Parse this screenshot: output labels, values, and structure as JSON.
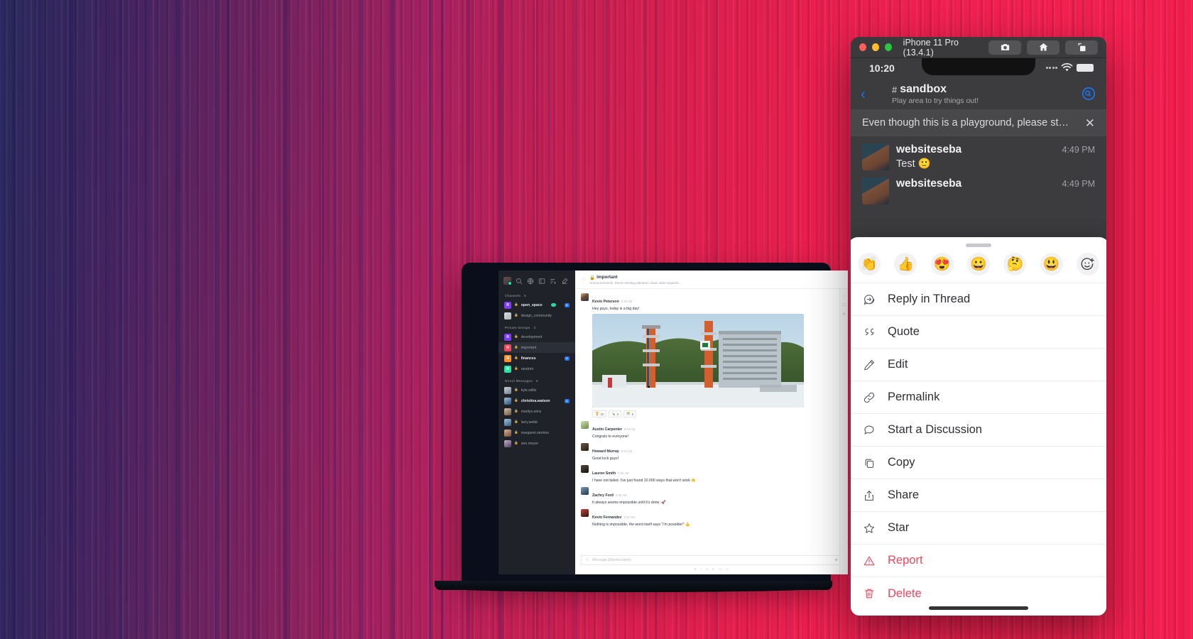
{
  "background": {
    "accent_pink": "#f3204f",
    "accent_indigo": "#2b2a5e"
  },
  "simulator": {
    "window_title": "iPhone 11 Pro (13.4.1)",
    "traffic_lights": [
      "close-red",
      "minimize-yellow",
      "zoom-green"
    ],
    "toolbar_buttons": [
      {
        "name": "screenshot-button",
        "icon": "camera-icon"
      },
      {
        "name": "home-button",
        "icon": "home-icon"
      },
      {
        "name": "rotate-button",
        "icon": "rotate-icon"
      }
    ],
    "status_bar": {
      "time": "10:20",
      "wifi": "wifi-icon",
      "battery": "battery-full-icon"
    },
    "nav": {
      "back": "chevron-left-icon",
      "hash": "#",
      "channel": "sandbox",
      "topic": "Play area to try things out!",
      "action": "search-message-icon"
    },
    "announcement": {
      "text": "Even though this is a playground, please st…",
      "close": "✕"
    },
    "messages": [
      {
        "user": "websiteseba",
        "time": "4:49 PM",
        "text": "Test 🙂"
      },
      {
        "user": "websiteseba",
        "time": "4:49 PM",
        "text": ""
      }
    ]
  },
  "action_sheet": {
    "grabber": "drag-handle",
    "reactions": [
      {
        "name": "clap-emoji",
        "glyph": "👏"
      },
      {
        "name": "thumbsup-emoji",
        "glyph": "👍"
      },
      {
        "name": "heart-eyes-emoji",
        "glyph": "😍"
      },
      {
        "name": "grinning-emoji",
        "glyph": "😀"
      },
      {
        "name": "thinking-emoji",
        "glyph": "🤔"
      },
      {
        "name": "smiley-emoji",
        "glyph": "😃"
      }
    ],
    "add_reaction": {
      "name": "add-reaction-icon",
      "label": ""
    },
    "items": [
      {
        "label": "Reply in Thread",
        "icon": "thread-icon",
        "danger": false
      },
      {
        "label": "Quote",
        "icon": "quote-icon",
        "danger": false
      },
      {
        "label": "Edit",
        "icon": "pencil-icon",
        "danger": false
      },
      {
        "label": "Permalink",
        "icon": "link-icon",
        "danger": false
      },
      {
        "label": "Start a Discussion",
        "icon": "discussion-icon",
        "danger": false
      },
      {
        "label": "Copy",
        "icon": "copy-icon",
        "danger": false
      },
      {
        "label": "Share",
        "icon": "share-icon",
        "danger": false
      },
      {
        "label": "Star",
        "icon": "star-icon",
        "danger": false
      },
      {
        "label": "Report",
        "icon": "warning-icon",
        "danger": true
      },
      {
        "label": "Delete",
        "icon": "trash-icon",
        "danger": true
      }
    ]
  },
  "desktop_app": {
    "sidebar": {
      "top_icons": [
        "avatar",
        "search-icon",
        "globe-icon",
        "directory-icon",
        "sort-icon",
        "compose-icon"
      ],
      "sections": [
        {
          "title": "Channels",
          "count": "5",
          "rooms": [
            {
              "name": "open_space",
              "unread": true,
              "badge": "8",
              "status": "video-icon",
              "avatar_color": "#7d3cf5",
              "avatar_letter": "R"
            },
            {
              "name": "design_community",
              "unread": false,
              "badge": "",
              "avatar_color": "#d8d8d8",
              "avatar_letter": ""
            }
          ]
        },
        {
          "title": "Private Groups",
          "count": "3",
          "rooms": [
            {
              "name": "development",
              "unread": false,
              "badge": "",
              "avatar_color": "#7d3cf5",
              "avatar_letter": "R"
            },
            {
              "name": "important",
              "unread": false,
              "badge": "",
              "avatar_color": "#f5455c",
              "avatar_letter": "R",
              "active": true
            },
            {
              "name": "finances",
              "unread": true,
              "badge": "3",
              "avatar_color": "#f59331",
              "avatar_letter": "R"
            },
            {
              "name": "random",
              "unread": false,
              "badge": "",
              "avatar_color": "#2de0a5",
              "avatar_letter": "R"
            }
          ]
        },
        {
          "title": "Direct Messages",
          "count": "6",
          "rooms": [
            {
              "name": "kyle.willis",
              "unread": false,
              "badge": "",
              "avatar_color": "#6b7a8a",
              "avatar_letter": ""
            },
            {
              "name": "christina.watson",
              "unread": true,
              "badge": "4",
              "avatar_color": "#3b5a7a",
              "avatar_letter": ""
            },
            {
              "name": "marilyn.sims",
              "unread": false,
              "badge": "",
              "avatar_color": "#8a6b5a",
              "avatar_letter": ""
            },
            {
              "name": "larry.webb",
              "unread": false,
              "badge": "",
              "avatar_color": "#4a6a8a",
              "avatar_letter": ""
            },
            {
              "name": "margaret.ramirez",
              "unread": false,
              "badge": "",
              "avatar_color": "#7a5a4a",
              "avatar_letter": ""
            },
            {
              "name": "ann.meyer",
              "unread": false,
              "badge": "",
              "avatar_color": "#5a4a6a",
              "avatar_letter": ""
            }
          ]
        }
      ]
    },
    "room_header": {
      "lock": "lock-icon",
      "name": "important",
      "topic": "Announcements, Items needing attention, team wide inquiries..."
    },
    "messages": [
      {
        "user": "Kevin Peterson",
        "time": "9:30 AM",
        "text": "Hey guys, today is a big day!",
        "has_image": true
      },
      {
        "user": "Austin Carpenter",
        "time": "9:32 AM",
        "text": "Congrats to everyone!",
        "has_image": false
      },
      {
        "user": "Howard Murray",
        "time": "9:33 AM",
        "text": "Good luck guys!",
        "has_image": false
      },
      {
        "user": "Lauren Smith",
        "time": "9:35 AM",
        "text": "I have not failed. I've just found 10.000 ways that won't work 👏",
        "has_image": false
      },
      {
        "user": "Zachry Ford",
        "time": "9:36 AM",
        "text": "It always seems impossible until it's done. 🚀",
        "has_image": false
      },
      {
        "user": "Kevin Fernandez",
        "time": "9:37 AM",
        "text": "Nothing is impossible, the word itself says “I'm possible!” 💪",
        "has_image": false
      }
    ],
    "reactions": [
      {
        "glyph": "🏆",
        "count": "20"
      },
      {
        "glyph": "🍾",
        "count": "5"
      },
      {
        "glyph": "🎊",
        "count": "8"
      }
    ],
    "composer": {
      "placeholder": "Message @bertie.barton",
      "emoji_icon": "emoji-icon",
      "plus_icon": "plus-icon",
      "format_icons": [
        "bold",
        "italic",
        "underline",
        "strike",
        "code",
        "multiline"
      ]
    }
  }
}
